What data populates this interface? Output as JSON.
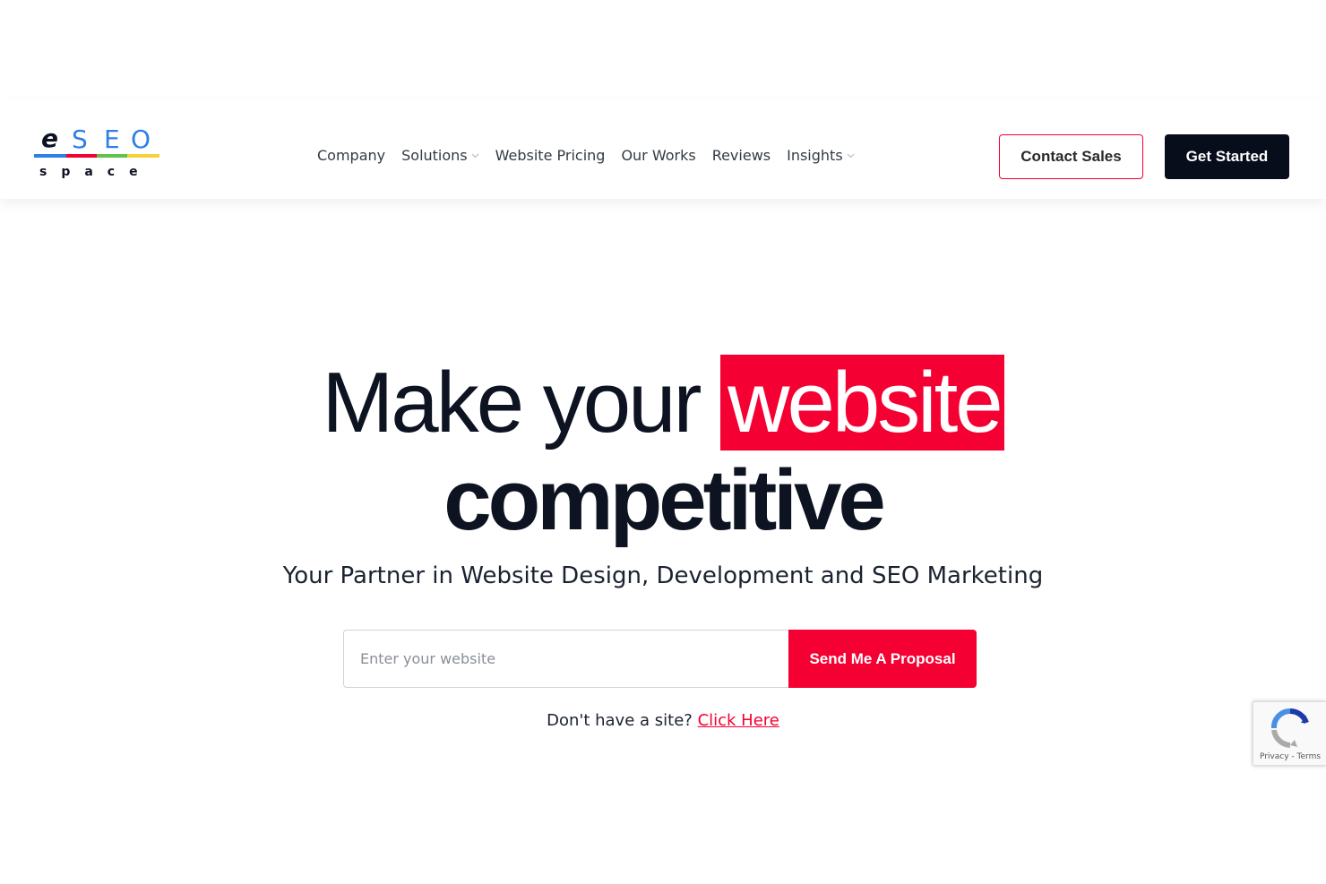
{
  "logo": {
    "top": "eSEO",
    "bottom": "space"
  },
  "nav": {
    "items": [
      {
        "label": "Company",
        "dropdown": false
      },
      {
        "label": "Solutions",
        "dropdown": true
      },
      {
        "label": "Website Pricing",
        "dropdown": false
      },
      {
        "label": "Our Works",
        "dropdown": false
      },
      {
        "label": "Reviews",
        "dropdown": false
      },
      {
        "label": "Insights",
        "dropdown": true
      }
    ]
  },
  "header": {
    "contact_label": "Contact Sales",
    "start_label": "Get Started"
  },
  "hero": {
    "line1_prefix": "Make your",
    "line1_highlight": "website",
    "line2": "competitive",
    "subtitle": "Your Partner in Website Design, Development and SEO Marketing"
  },
  "form": {
    "placeholder": "Enter your website",
    "button_label": "Send Me A Proposal"
  },
  "nosite": {
    "prefix": "Don't have a site?",
    "link": "Click Here"
  },
  "recaptcha": {
    "privacy": "Privacy",
    "separator": "-",
    "terms": "Terms",
    "icon": "recaptcha-icon"
  },
  "colors": {
    "accent": "#f50032",
    "dark": "#070d1a",
    "logo_blue": "#2f7fe8",
    "logo_green": "#5fc24a",
    "logo_yellow": "#f5d23a"
  }
}
